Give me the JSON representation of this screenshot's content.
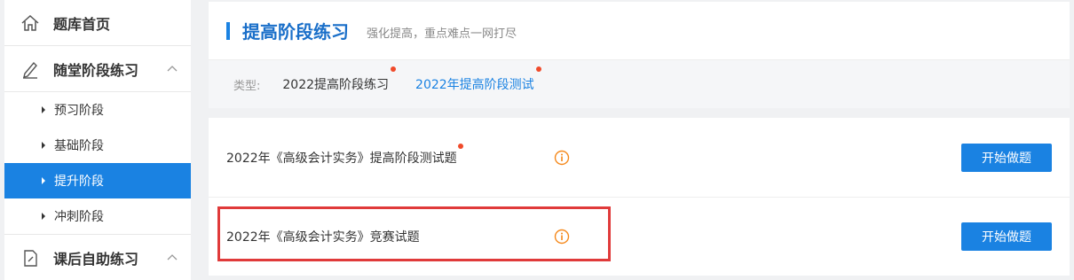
{
  "sidebar": {
    "sections": [
      {
        "label": "题库首页",
        "icon": "home-icon"
      },
      {
        "label": "随堂阶段练习",
        "icon": "pencil-icon",
        "expanded": true
      },
      {
        "label": "课后自助练习",
        "icon": "document-icon",
        "expanded": true
      }
    ],
    "subitems": [
      "预习阶段",
      "基础阶段",
      "提升阶段",
      "冲刺阶段"
    ],
    "active_subitem": "提升阶段"
  },
  "header": {
    "title": "提高阶段练习",
    "subtitle": "强化提高，重点难点一网打尽",
    "type_label": "类型:",
    "type_options": [
      "2022提高阶段练习",
      "2022年提高阶段测试"
    ],
    "active_type": "2022年提高阶段测试"
  },
  "exams": [
    {
      "title": "2022年《高级会计实务》提高阶段测试题",
      "button": "开始做题",
      "new": true
    },
    {
      "title": "2022年《高级会计实务》竞赛试题",
      "button": "开始做题",
      "new": false
    }
  ],
  "colors": {
    "accent": "#1a82e2",
    "dot": "#f04a2a",
    "info": "#f5891c",
    "highlight": "#e03a3a"
  }
}
